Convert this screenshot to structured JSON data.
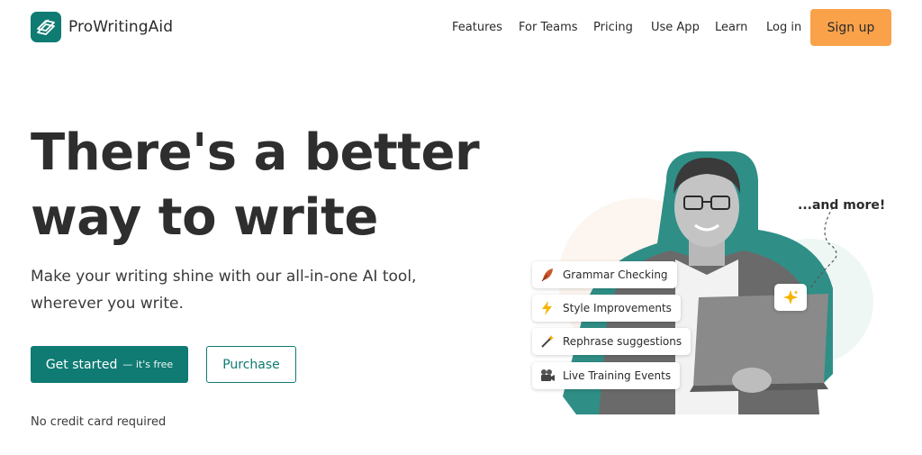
{
  "header": {
    "logo_text": "ProWritingAid",
    "nav": [
      {
        "label": "Features"
      },
      {
        "label": "For Teams"
      },
      {
        "label": "Pricing"
      },
      {
        "label": "Use App"
      },
      {
        "label": "Learn"
      },
      {
        "label": "Log in"
      }
    ],
    "signup_label": "Sign up"
  },
  "hero": {
    "title_line1": "There's a better",
    "title_line2": "way to write",
    "subtitle_line1": "Make your writing shine with our all-in-one AI tool,",
    "subtitle_line2": "wherever you write.",
    "cta_primary": "Get started",
    "cta_primary_suffix": "— it's free",
    "cta_secondary": "Purchase",
    "note": "No credit card required"
  },
  "illustration": {
    "more_label": "...and more!",
    "features": [
      {
        "label": "Grammar Checking",
        "icon": "quill-icon"
      },
      {
        "label": "Style Improvements",
        "icon": "lightning-icon"
      },
      {
        "label": "Rephrase suggestions",
        "icon": "magic-wand-icon"
      },
      {
        "label": "Live Training Events",
        "icon": "video-camera-icon"
      }
    ],
    "sparkle_icon": "sparkle-icon"
  },
  "colors": {
    "brand": "#0f7b73",
    "accent": "#f9a24a",
    "text": "#2b2b2b"
  }
}
